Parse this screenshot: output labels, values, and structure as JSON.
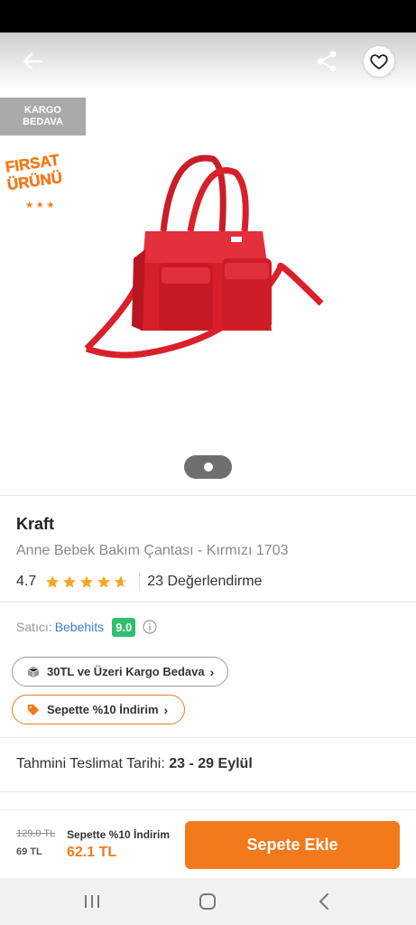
{
  "badges": {
    "kargo_line1": "KARGO",
    "kargo_line2": "BEDAVA",
    "firsat_line1": "FIRSAT",
    "firsat_line2": "ÜRÜNÜ"
  },
  "product": {
    "brand": "Kraft",
    "name": "Anne Bebek Bakım Çantası - Kırmızı 1703",
    "rating": "4.7",
    "rating_value": 4.7,
    "review_count": "23 Değerlendirme"
  },
  "seller": {
    "label": "Satıcı:",
    "name": "Bebehits",
    "score": "9.0"
  },
  "promos": {
    "kargo": "30TL ve Üzeri Kargo Bedava",
    "indirim": "Sepette %10 İndirim"
  },
  "delivery": {
    "label": "Tahmini Teslimat Tarihi:",
    "dates": "23 - 29 Eylül"
  },
  "bottom": {
    "old_price": "129.0 TL",
    "mid_price": "69 TL",
    "promo_label": "Sepette %10 İndirim",
    "final_price": "62.1 TL",
    "add_to_cart": "Sepete Ekle"
  },
  "colors": {
    "accent": "#f27a1a",
    "star": "#f5a623",
    "seller_score": "#2fbf71",
    "seller_link": "#3d7fd6"
  },
  "icons": {
    "back": "arrow-left-icon",
    "share": "share-icon",
    "favorite": "heart-icon",
    "info": "info-icon",
    "box": "box-icon",
    "tag": "tag-icon",
    "nav_recent": "recent-apps-icon",
    "nav_home": "home-icon",
    "nav_back": "nav-back-icon"
  }
}
